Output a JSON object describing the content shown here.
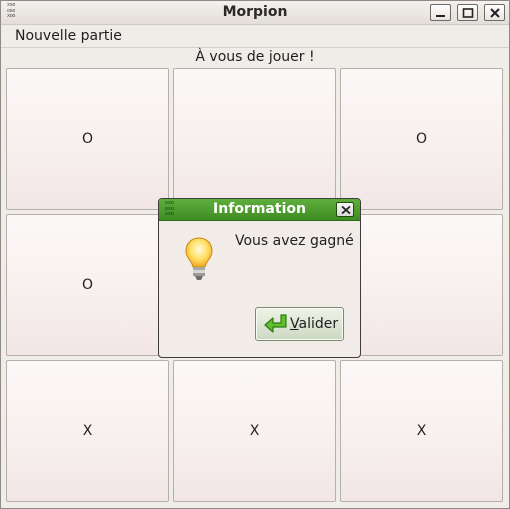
{
  "window": {
    "title": "Morpion",
    "icon": "xxo-grid-icon",
    "icon_rows": [
      "xxo",
      "oxo",
      "xoo"
    ]
  },
  "menu": {
    "items": [
      {
        "label": "Nouvelle partie"
      }
    ]
  },
  "status": "À vous de jouer !",
  "board": {
    "cells": [
      "O",
      "",
      "O",
      "O",
      "",
      "",
      "X",
      "X",
      "X"
    ]
  },
  "dialog": {
    "title": "Information",
    "message": "Vous avez gagné",
    "icon": "lightbulb-icon",
    "button": {
      "mnemonic": "V",
      "rest": "alider",
      "icon": "enter-arrow-icon"
    },
    "title_color": "#4a9a2c"
  }
}
